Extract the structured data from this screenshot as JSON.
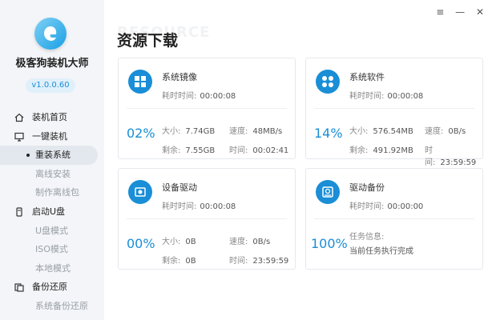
{
  "app": {
    "name": "极客狗装机大师",
    "version": "v1.0.0.60",
    "watermark": "RESOURCE"
  },
  "window": {
    "min": "—",
    "menu": "≡"
  },
  "nav": {
    "home": "装机首页",
    "onekey": "一键装机",
    "reinstall": "重装系统",
    "offline_install": "离线安装",
    "make_offline": "制作离线包",
    "usb_boot": "启动U盘",
    "usb_mode": "U盘模式",
    "iso_mode": "ISO模式",
    "local_mode": "本地模式",
    "backup": "备份还原",
    "sys_backup": "系统备份还原"
  },
  "page": {
    "title": "资源下载"
  },
  "labels": {
    "elapsed": "耗时时间:",
    "size": "大小:",
    "speed": "速度:",
    "remain": "剩余:",
    "time": "时间:",
    "task_info": "任务信息:"
  },
  "cards": {
    "sysimg": {
      "title": "系统镜像",
      "elapsed": "00:00:08",
      "percent": "02%",
      "size": "7.74GB",
      "speed": "48MB/s",
      "remain": "7.55GB",
      "time": "00:02:41"
    },
    "software": {
      "title": "系统软件",
      "elapsed": "00:00:08",
      "percent": "14%",
      "size": "576.54MB",
      "speed": "0B/s",
      "remain": "491.92MB",
      "time": "23:59:59"
    },
    "driver": {
      "title": "设备驱动",
      "elapsed": "00:00:08",
      "percent": "00%",
      "size": "0B",
      "speed": "0B/s",
      "remain": "0B",
      "time": "23:59:59"
    },
    "backup": {
      "title": "驱动备份",
      "elapsed": "00:00:00",
      "percent": "100%",
      "task": "当前任务执行完成"
    }
  }
}
